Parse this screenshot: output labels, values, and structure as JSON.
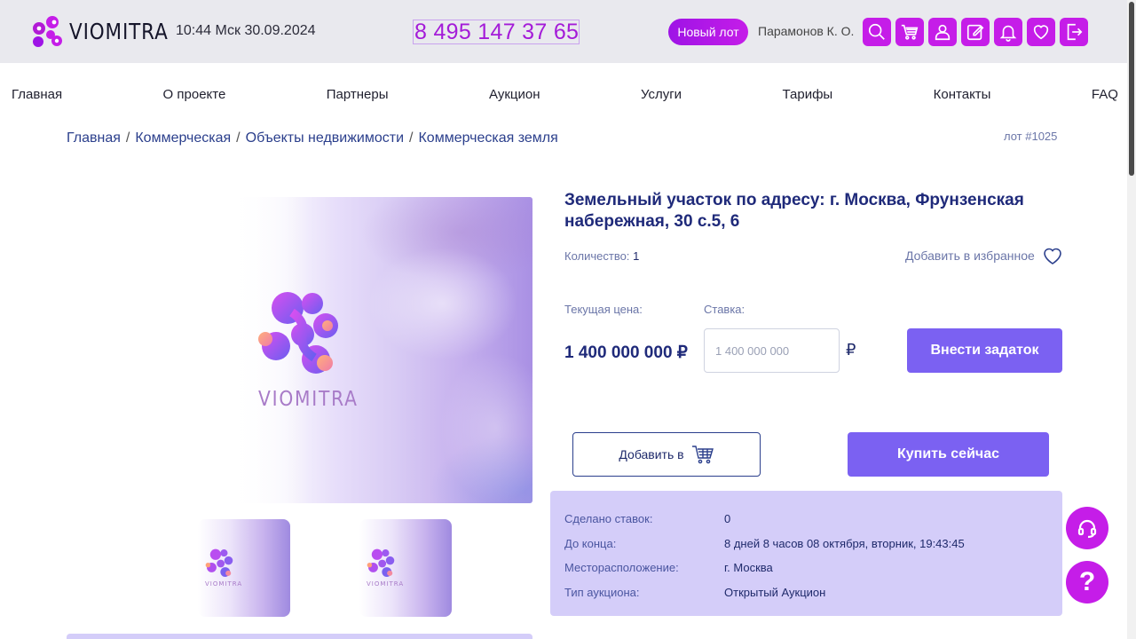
{
  "header": {
    "brand": "VIOMITRA",
    "datetime": "10:44 Мск 30.09.2024",
    "phone": "8 495 147 37 65",
    "new_lot_label": "Новый лот",
    "username": "Парамонов К. О.",
    "icons": [
      "search-icon",
      "cart-icon",
      "user-icon",
      "edit-icon",
      "bell-icon",
      "heart-icon",
      "logout-icon"
    ],
    "accent_color": "#c51de8"
  },
  "nav": {
    "items": [
      "Главная",
      "О проекте",
      "Партнеры",
      "Аукцион",
      "Услуги",
      "Тарифы",
      "Контакты",
      "FAQ"
    ]
  },
  "breadcrumb": {
    "items": [
      "Главная",
      "Коммерческая",
      "Объекты недвижимости",
      "Коммерческая земля"
    ],
    "separator": "/"
  },
  "lot": {
    "number": "лот #1025",
    "image_brand": "VIOMITRA",
    "title": "Земельный участок по адресу: г. Москва, Фрунзенская набережная, 30 с.5, 6",
    "quantity_label": "Количество:",
    "quantity_value": "1",
    "favorite_label": "Добавить в избранное",
    "current_price_label": "Текущая цена:",
    "current_price": "1 400 000 000 ₽",
    "bid_label": "Ставка:",
    "bid_placeholder": "1 400 000 000",
    "currency": "₽",
    "deposit_button": "Внести задаток",
    "add_to_cart_button": "Добавить в",
    "buy_now_button": "Купить сейчас",
    "button_color": "#7b61f2"
  },
  "info": {
    "rows": [
      {
        "key": "Сделано ставок:",
        "value": "0"
      },
      {
        "key": "До конца:",
        "value": "8 дней 8 часов 08 октября, вторник, 19:43:45"
      },
      {
        "key": "Месторасположение:",
        "value": "г. Москва"
      },
      {
        "key": "Тип аукциона:",
        "value": "Открытый Аукцион"
      }
    ]
  },
  "floating": {
    "support_icon": "headset-icon",
    "help_label": "?"
  }
}
